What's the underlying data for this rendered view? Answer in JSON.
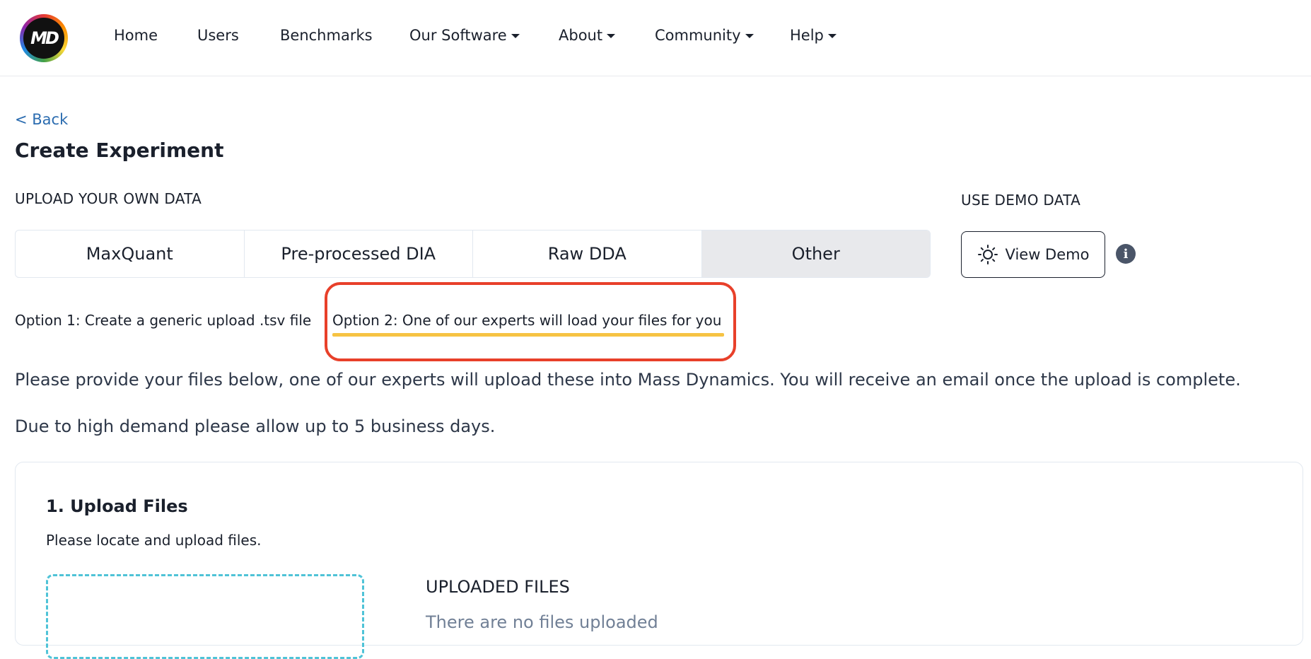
{
  "nav": {
    "logo_text": "MD",
    "items": [
      {
        "label": "Home",
        "dropdown": false
      },
      {
        "label": "Users",
        "dropdown": false
      },
      {
        "label": "Benchmarks",
        "dropdown": false
      },
      {
        "label": "Our Software",
        "dropdown": true
      },
      {
        "label": "About",
        "dropdown": true
      },
      {
        "label": "Community",
        "dropdown": true
      },
      {
        "label": "Help",
        "dropdown": true
      }
    ]
  },
  "back_label": "< Back",
  "page_title": "Create Experiment",
  "upload_section": {
    "label": "UPLOAD YOUR OWN DATA",
    "tabs": [
      "MaxQuant",
      "Pre-processed DIA",
      "Raw DDA",
      "Other"
    ],
    "active_tab": "Other"
  },
  "demo_section": {
    "label": "USE DEMO DATA",
    "button_label": "View Demo",
    "info_glyph": "i"
  },
  "options": {
    "option1": "Option 1: Create a generic upload .tsv file",
    "option2": "Option 2: One of our experts will load your files for you",
    "selected": "option2",
    "underline_color": "#f6c343",
    "highlight_color": "#e8402a"
  },
  "instructions": {
    "line1": "Please provide your files below, one of our experts will upload these into Mass Dynamics. You will receive an email once the upload is complete.",
    "line2": "Due to high demand please allow up to 5 business days."
  },
  "upload_card": {
    "title": "1. Upload Files",
    "subtitle": "Please locate and upload files.",
    "uploaded_label": "UPLOADED FILES",
    "empty_text": "There are no files uploaded"
  },
  "colors": {
    "link": "#2b6cb0",
    "dropzone_border": "#4fc3d7",
    "active_tab_bg": "#e8e9ec"
  }
}
